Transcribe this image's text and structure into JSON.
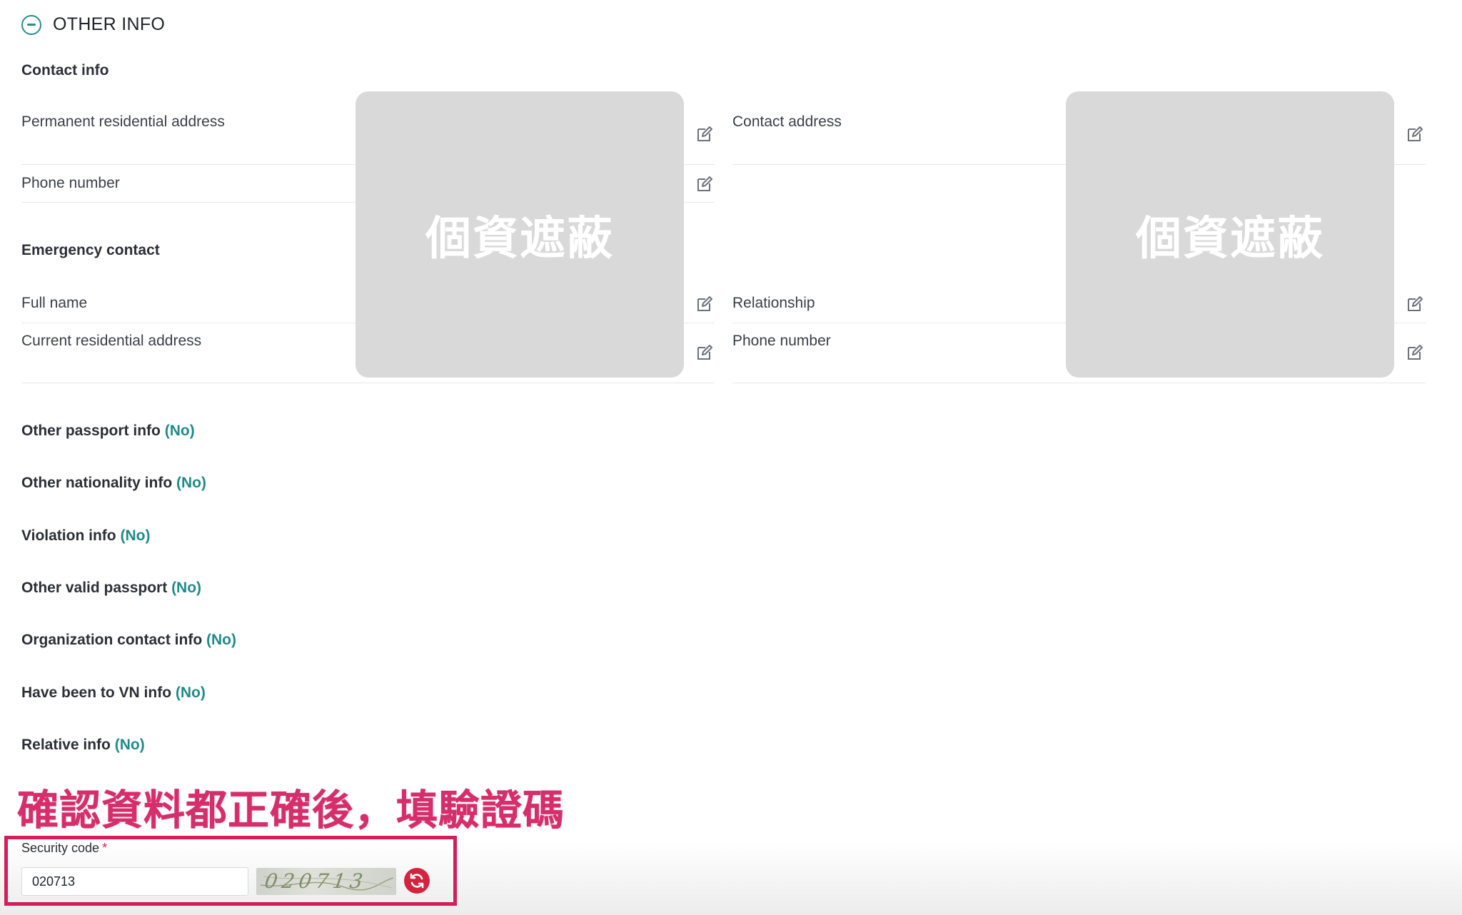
{
  "section": {
    "title": "OTHER INFO"
  },
  "contact": {
    "heading": "Contact info",
    "permanent_address_label": "Permanent residential address",
    "contact_address_label": "Contact address",
    "phone_label": "Phone number"
  },
  "emergency": {
    "heading": "Emergency contact",
    "full_name_label": "Full name",
    "relationship_label": "Relationship",
    "current_address_label": "Current residential address",
    "phone_label": "Phone number"
  },
  "mask": {
    "left_text": "個資遮蔽",
    "right_text": "個資遮蔽"
  },
  "info_rows": [
    {
      "label": "Other passport info",
      "status": "(No)"
    },
    {
      "label": "Other nationality info",
      "status": "(No)"
    },
    {
      "label": "Violation info",
      "status": "(No)"
    },
    {
      "label": "Other valid passport",
      "status": "(No)"
    },
    {
      "label": "Organization contact info",
      "status": "(No)"
    },
    {
      "label": "Have been to VN info",
      "status": "(No)"
    },
    {
      "label": "Relative info",
      "status": "(No)"
    }
  ],
  "annotation": {
    "text": "確認資料都正確後，填驗證碼"
  },
  "security": {
    "label": "Security code",
    "required_mark": "*",
    "value": "020713",
    "captcha_text": "020713"
  },
  "colors": {
    "accent": "#2a8c8c",
    "highlight": "#d41e5a",
    "refresh": "#d4223f",
    "mask": "#d9d9d9"
  }
}
